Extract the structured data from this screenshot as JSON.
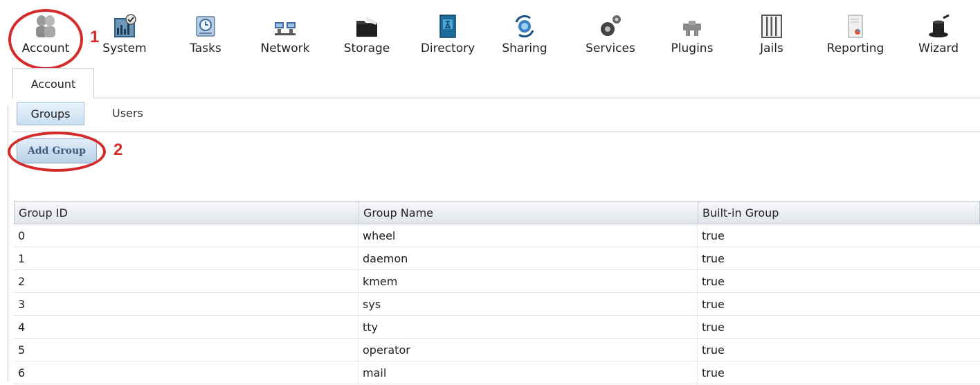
{
  "toolbar": {
    "items": [
      {
        "label": "Account",
        "icon": "account-icon"
      },
      {
        "label": "System",
        "icon": "system-icon"
      },
      {
        "label": "Tasks",
        "icon": "tasks-icon"
      },
      {
        "label": "Network",
        "icon": "network-icon"
      },
      {
        "label": "Storage",
        "icon": "storage-icon"
      },
      {
        "label": "Directory",
        "icon": "directory-icon"
      },
      {
        "label": "Sharing",
        "icon": "sharing-icon"
      },
      {
        "label": "Services",
        "icon": "services-icon"
      },
      {
        "label": "Plugins",
        "icon": "plugins-icon"
      },
      {
        "label": "Jails",
        "icon": "jails-icon"
      },
      {
        "label": "Reporting",
        "icon": "reporting-icon"
      },
      {
        "label": "Wizard",
        "icon": "wizard-icon"
      }
    ]
  },
  "tabs": {
    "active": "Account"
  },
  "subtabs": {
    "groups": "Groups",
    "users": "Users"
  },
  "actions": {
    "add_group": "Add Group"
  },
  "annotations": {
    "one": "1",
    "two": "2",
    "color": "#d42a2a"
  },
  "grid": {
    "columns": [
      "Group ID",
      "Group Name",
      "Built-in Group"
    ],
    "rows": [
      [
        "0",
        "wheel",
        "true"
      ],
      [
        "1",
        "daemon",
        "true"
      ],
      [
        "2",
        "kmem",
        "true"
      ],
      [
        "3",
        "sys",
        "true"
      ],
      [
        "4",
        "tty",
        "true"
      ],
      [
        "5",
        "operator",
        "true"
      ],
      [
        "6",
        "mail",
        "true"
      ]
    ]
  }
}
